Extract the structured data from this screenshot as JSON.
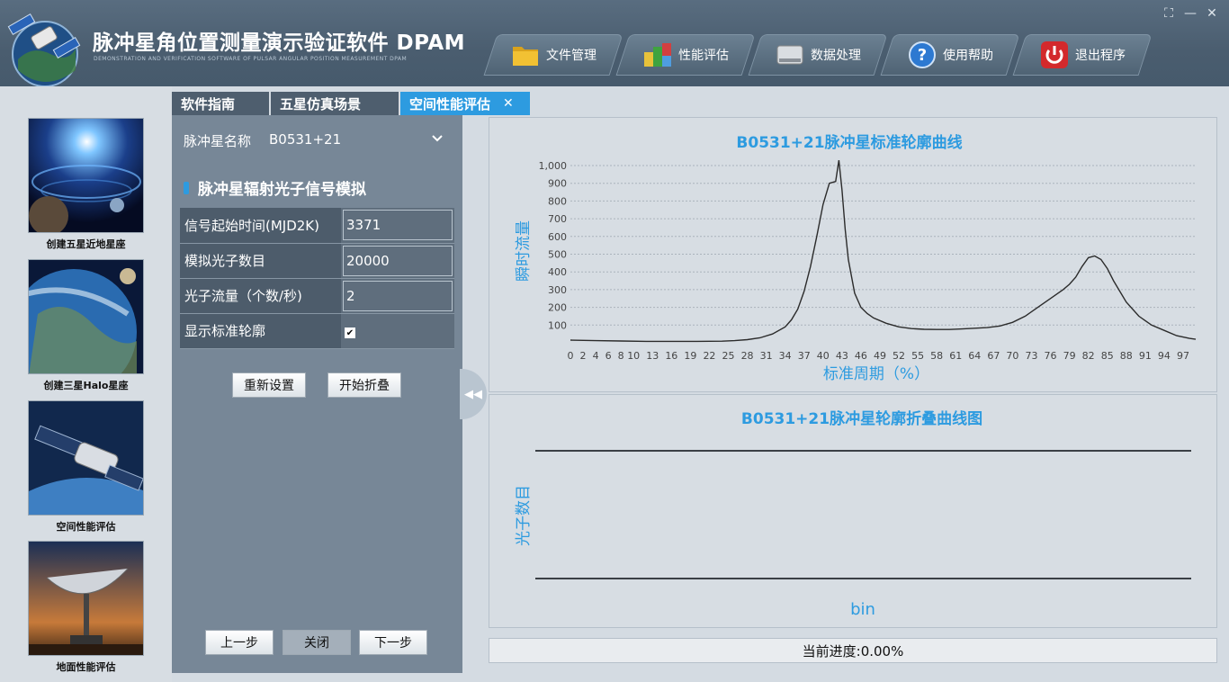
{
  "header": {
    "title": "脉冲星角位置测量演示验证软件 DPAM",
    "subtitle": "DEMONSTRATION AND VERIFICATION SOFTWARE OF PULSAR ANGULAR POSITION MEASUREMENT DPAM",
    "window_controls": [
      "⛶",
      "—",
      "✕"
    ],
    "nav": [
      {
        "label": "文件管理",
        "icon": "folder-icon"
      },
      {
        "label": "性能评估",
        "icon": "cubes-icon"
      },
      {
        "label": "数据处理",
        "icon": "disk-icon"
      },
      {
        "label": "使用帮助",
        "icon": "help-icon"
      },
      {
        "label": "退出程序",
        "icon": "power-icon"
      }
    ]
  },
  "sidebar": {
    "items": [
      {
        "label": "创建五星近地星座"
      },
      {
        "label": "创建三星Halo星座"
      },
      {
        "label": "空间性能评估"
      },
      {
        "label": "地面性能评估"
      }
    ]
  },
  "tabs": [
    {
      "label": "软件指南",
      "active": false
    },
    {
      "label": "五星仿真场景",
      "active": false
    },
    {
      "label": "空间性能评估",
      "active": true,
      "close": "✕"
    }
  ],
  "panel": {
    "pulsar_label": "脉冲星名称",
    "pulsar_value": "B0531+21",
    "section_title": "脉冲星辐射光子信号模拟",
    "params": [
      {
        "label": "信号起始时间(MJD2K)",
        "value": "3371"
      },
      {
        "label": "模拟光子数目",
        "value": "20000"
      },
      {
        "label": "光子流量（个数/秒)",
        "value": "2"
      }
    ],
    "show_profile_label": "显示标准轮廓",
    "show_profile_checked": true,
    "reset_button": "重新设置",
    "fold_button": "开始折叠",
    "prev_button": "上一步",
    "close_button": "关闭",
    "next_button": "下一步"
  },
  "chart_data": [
    {
      "type": "line",
      "title": "B0531+21脉冲星标准轮廓曲线",
      "xlabel": "标准周期（%）",
      "ylabel": "瞬时流量",
      "xlim": [
        0,
        99
      ],
      "ylim": [
        0,
        1000
      ],
      "x_ticks": [
        "0",
        "2",
        "4",
        "6",
        "8",
        "10",
        "13",
        "16",
        "19",
        "22",
        "25",
        "28",
        "31",
        "34",
        "37",
        "40",
        "43",
        "46",
        "49",
        "52",
        "55",
        "58",
        "61",
        "64",
        "67",
        "70",
        "73",
        "76",
        "79",
        "82",
        "85",
        "88",
        "91",
        "94",
        "97"
      ],
      "y_ticks": [
        "100",
        "200",
        "300",
        "400",
        "500",
        "600",
        "700",
        "800",
        "900",
        "1,000"
      ],
      "color": "#2b2b2b",
      "title_color": "#2d9be0",
      "grid": true,
      "series": [
        {
          "x": [
            0,
            4,
            8,
            12,
            16,
            20,
            24,
            26,
            28,
            30,
            32,
            34,
            35,
            36,
            37,
            38,
            39,
            40,
            41,
            42,
            42.5,
            43,
            43.5,
            44,
            45,
            46,
            47,
            48,
            50,
            52,
            54,
            56,
            58,
            60,
            62,
            64,
            66,
            68,
            70,
            72,
            74,
            76,
            78,
            79,
            80,
            81,
            82,
            83,
            84,
            85,
            86,
            88,
            90,
            92,
            94,
            96,
            98,
            99
          ],
          "y": [
            15,
            12,
            10,
            8,
            8,
            8,
            9,
            12,
            18,
            28,
            50,
            90,
            130,
            190,
            290,
            430,
            600,
            780,
            900,
            910,
            1030,
            860,
            640,
            470,
            280,
            200,
            165,
            140,
            110,
            90,
            80,
            76,
            75,
            75,
            78,
            82,
            86,
            95,
            115,
            150,
            200,
            250,
            300,
            330,
            370,
            430,
            480,
            490,
            470,
            420,
            350,
            230,
            150,
            100,
            70,
            40,
            25,
            20
          ]
        }
      ]
    },
    {
      "type": "line",
      "title": "B0531+21脉冲星轮廓折叠曲线图",
      "xlabel": "bin",
      "ylabel": "光子数目",
      "title_color": "#2d9be0",
      "series": []
    }
  ],
  "progress": {
    "label": "当前进度:0.00%",
    "fraction": 0.0
  }
}
